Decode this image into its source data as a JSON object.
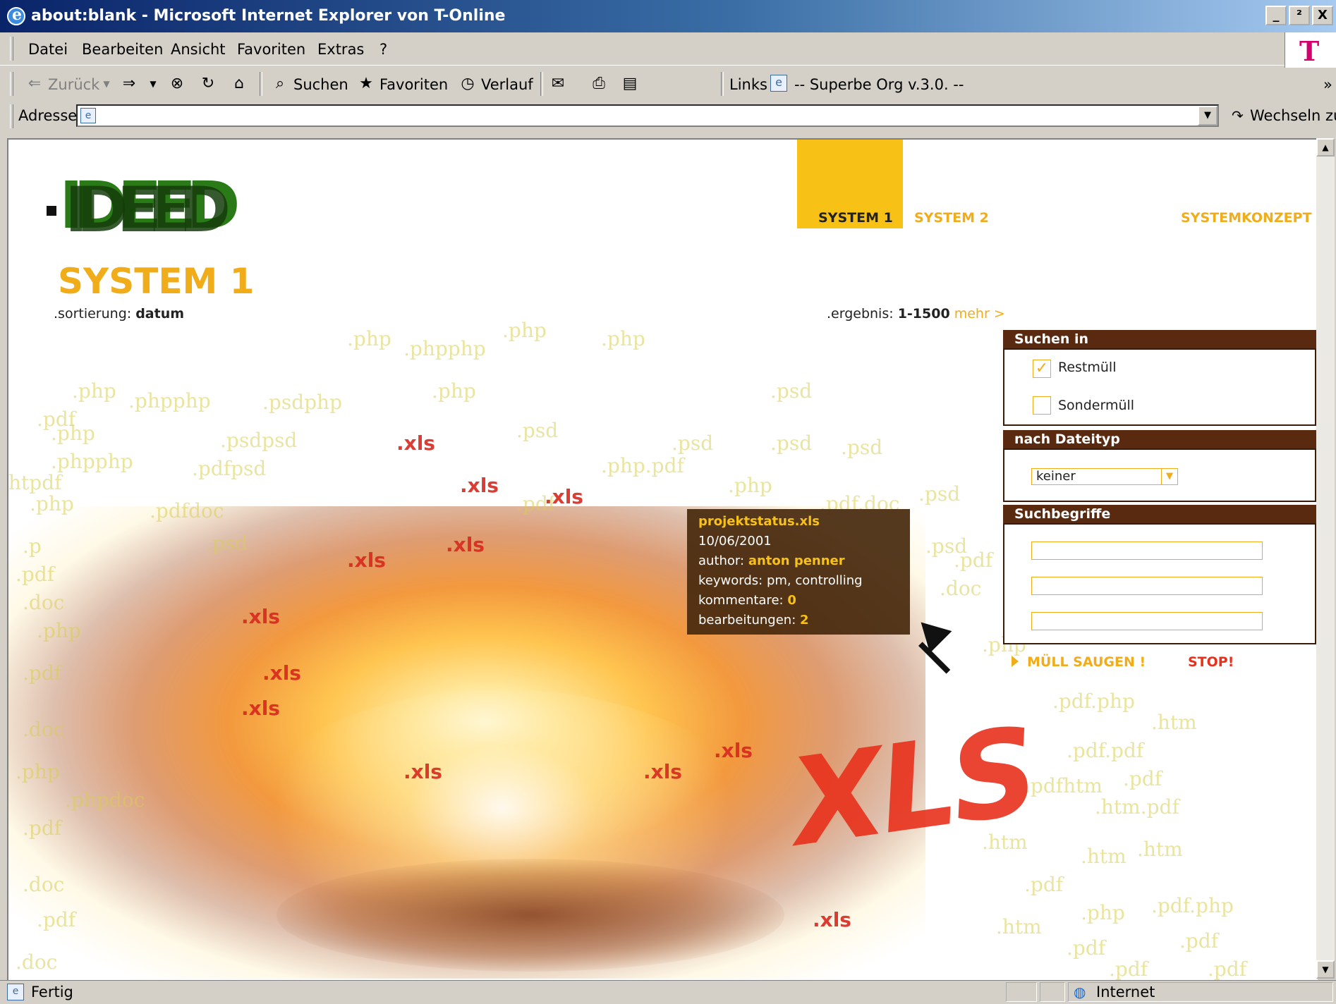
{
  "window": {
    "title": "about:blank - Microsoft Internet Explorer von T-Online",
    "buttons": [
      "_",
      "²",
      "X"
    ]
  },
  "menu": {
    "items": [
      "Datei",
      "Bearbeiten",
      "Ansicht",
      "Favoriten",
      "Extras",
      "?"
    ]
  },
  "brand": {
    "logo_text": "T"
  },
  "toolbar": {
    "back": "Zurück",
    "search": "Suchen",
    "favorites": "Favoriten",
    "history": "Verlauf",
    "links_label": "Links",
    "link1": "-- Superbe Org v.3.0. --",
    "chevron": "»"
  },
  "address": {
    "label": "Adresse",
    "value": "",
    "go_label": "Wechseln zu"
  },
  "page": {
    "logo_text": "IDEED",
    "title": "SYSTEM 1",
    "sort_label": ".sortierung:",
    "sort_value": "datum",
    "nav": [
      "SYSTEM 1",
      "SYSTEM 2",
      "SYSTEMKONZEPT"
    ],
    "results_label": ".ergebnis:",
    "results_value": "1-1500",
    "results_more": "mehr >",
    "search_in": {
      "heading": "Suchen in",
      "options": [
        {
          "label": "Restmüll",
          "checked": true
        },
        {
          "label": "Sondermüll",
          "checked": false
        }
      ]
    },
    "file_type": {
      "heading": "nach Dateityp",
      "selected": "keiner"
    },
    "terms": {
      "heading": "Suchbegriffe",
      "values": [
        "",
        "",
        ""
      ]
    },
    "action_go": "MÜLL SAUGEN !",
    "action_stop": "STOP!",
    "tooltip": {
      "filename": "projektstatus.xls",
      "date": "10/06/2001",
      "author_label": "author:",
      "author": "anton penner",
      "keywords_label": "keywords:",
      "keywords": "pm, controlling",
      "comments_label": "kommentare:",
      "comments": "0",
      "edits_label": "bearbeitungen:",
      "edits": "2"
    },
    "big_word": "XLS"
  },
  "status": {
    "text": "Fertig",
    "zone": "Internet"
  },
  "colors": {
    "accent": "#f1ac1a",
    "nav_active": "#f7c115",
    "panel_head": "#5a2a10",
    "stop": "#e8311c",
    "logo_green": "#2a7a18"
  }
}
